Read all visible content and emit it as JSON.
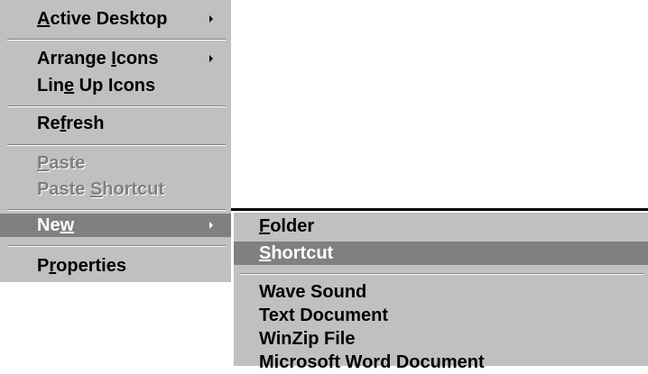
{
  "context_menu": {
    "items": [
      {
        "label_ul": "A",
        "label_rest": "ctive Desktop",
        "has_submenu": true,
        "enabled": true
      },
      {
        "label_pre": "Arrange ",
        "label_ul": "I",
        "label_rest": "cons",
        "has_submenu": true,
        "enabled": true
      },
      {
        "label_pre": "Lin",
        "label_ul": "e",
        "label_rest": " Up Icons",
        "has_submenu": false,
        "enabled": true
      },
      {
        "label_pre": "Re",
        "label_ul": "f",
        "label_rest": "resh",
        "has_submenu": false,
        "enabled": true
      },
      {
        "label_ul": "P",
        "label_rest": "aste",
        "has_submenu": false,
        "enabled": false
      },
      {
        "label_pre": "Paste ",
        "label_ul": "S",
        "label_rest": "hortcut",
        "has_submenu": false,
        "enabled": false
      },
      {
        "label_pre": "Ne",
        "label_ul": "w",
        "label_rest": "",
        "has_submenu": true,
        "enabled": true,
        "highlighted": true
      },
      {
        "label_pre": "P",
        "label_ul": "r",
        "label_rest": "operties",
        "has_submenu": false,
        "enabled": true
      }
    ]
  },
  "new_submenu": {
    "items": [
      {
        "label_ul": "F",
        "label_rest": "older",
        "highlighted": false
      },
      {
        "label_ul": "S",
        "label_rest": "hortcut",
        "highlighted": true
      },
      {
        "label": "Wave Sound"
      },
      {
        "label": "Text Document"
      },
      {
        "label": "WinZip File"
      },
      {
        "label": "Microsoft Word Document"
      }
    ]
  },
  "colors": {
    "menu_bg": "#c0c0c0",
    "highlight_bg": "#808080",
    "disabled_text": "#808080"
  },
  "icons": {
    "submenu_arrow": "triangle-right"
  }
}
